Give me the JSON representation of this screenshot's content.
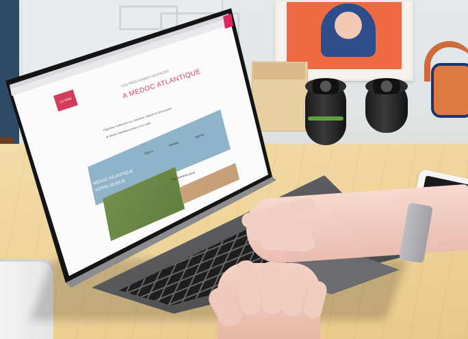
{
  "scene": {
    "description_tags": [
      "laptop",
      "hands-typing",
      "desk",
      "camera-lenses",
      "smartphone",
      "mug",
      "headphones",
      "poster"
    ]
  },
  "website": {
    "logo_label": "La Virée",
    "subtitle": "VOS PROCHAINES VACANCES",
    "title": "A MEDOC ATLANTIQUE",
    "intro_line1": "Organisez facilement vos vacances, séjours et découvertes",
    "intro_line2": "de Médoc Atlantique grâce à nos outils",
    "band_title_line1": "MEDOC ATLANTIQUE",
    "band_title_line2": "VOTRE SEJOUR",
    "nav": [
      "Séjours",
      "Activités",
      "Agenda"
    ],
    "news_heading": "Nos dernières actus"
  },
  "colors": {
    "accent_pink": "#d23d5c",
    "band_blue": "#8fb3c9",
    "desk_wood": "#efd49b"
  }
}
